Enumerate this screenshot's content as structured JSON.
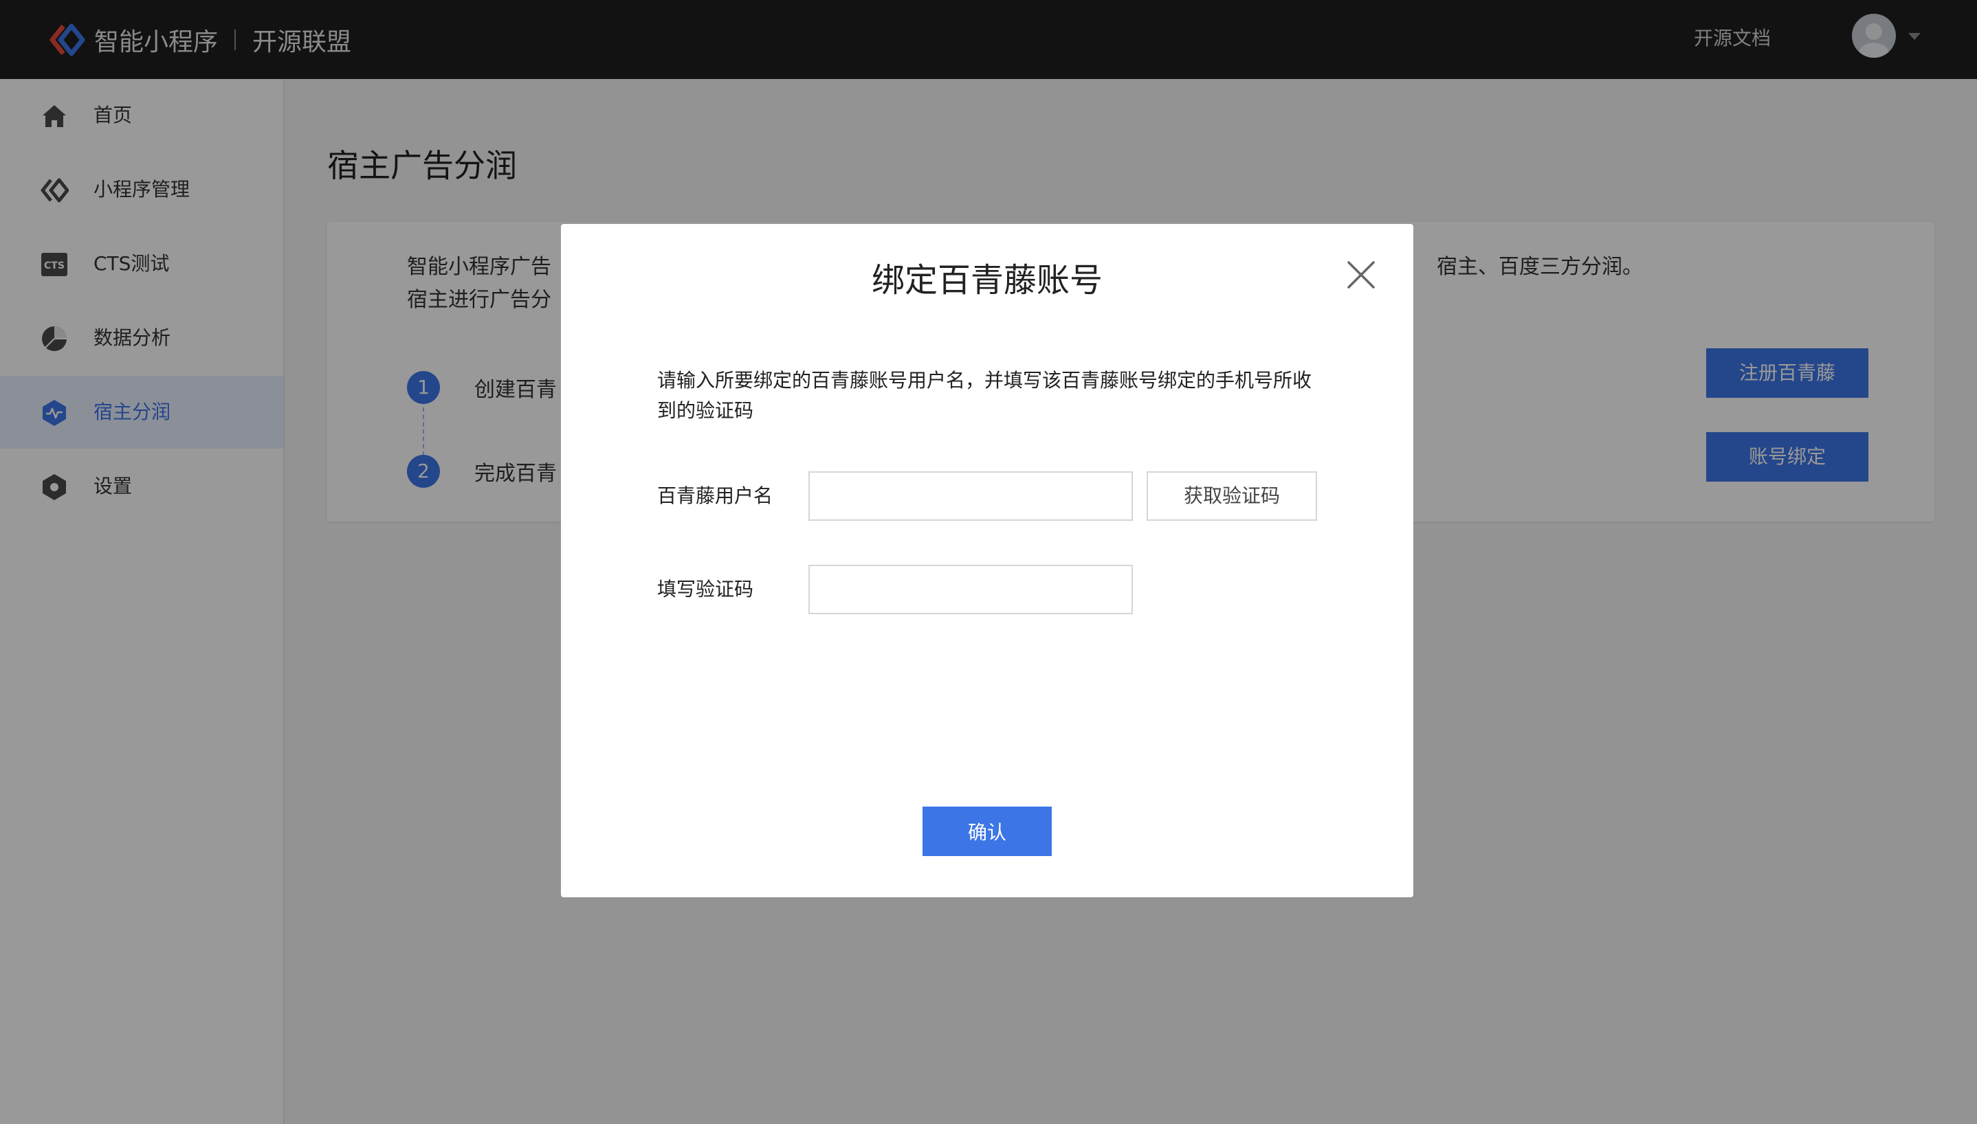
{
  "header": {
    "brand": "智能小程序",
    "brand_sub": "开源联盟",
    "doc_link": "开源文档",
    "logo_icon": "swan-logo-icon",
    "avatar_icon": "user-avatar-icon"
  },
  "sidebar": {
    "items": [
      {
        "label": "首页",
        "icon": "home-icon",
        "active": false
      },
      {
        "label": "小程序管理",
        "icon": "chevrons-icon",
        "active": false
      },
      {
        "label": "CTS测试",
        "icon": "cts-icon",
        "active": false
      },
      {
        "label": "数据分析",
        "icon": "pie-chart-icon",
        "active": false
      },
      {
        "label": "宿主分润",
        "icon": "pulse-hexagon-icon",
        "active": true
      },
      {
        "label": "设置",
        "icon": "hexagon-gear-icon",
        "active": false
      }
    ]
  },
  "main": {
    "title": "宿主广告分润",
    "description_line1_start": "智能小程序广告",
    "description_line1_end": "宿主、百度三方分润。",
    "description_line2_start": "宿主进行广告分",
    "steps": [
      {
        "number": "1",
        "label": "创建百青"
      },
      {
        "number": "2",
        "label": "完成百青"
      }
    ],
    "buttons": {
      "register": "注册百青藤",
      "bind": "账号绑定"
    }
  },
  "modal": {
    "title": "绑定百青藤账号",
    "description": "请输入所要绑定的百青藤账号用户名，并填写该百青藤账号绑定的手机号所收到的验证码",
    "username_label": "百青藤用户名",
    "username_value": "",
    "get_code_label": "获取验证码",
    "code_label": "填写验证码",
    "code_value": "",
    "confirm_label": "确认"
  },
  "colors": {
    "accent": "#3c76e6",
    "topbar": "#1f1f1f",
    "overlay": "rgba(0,0,0,0.4)"
  }
}
